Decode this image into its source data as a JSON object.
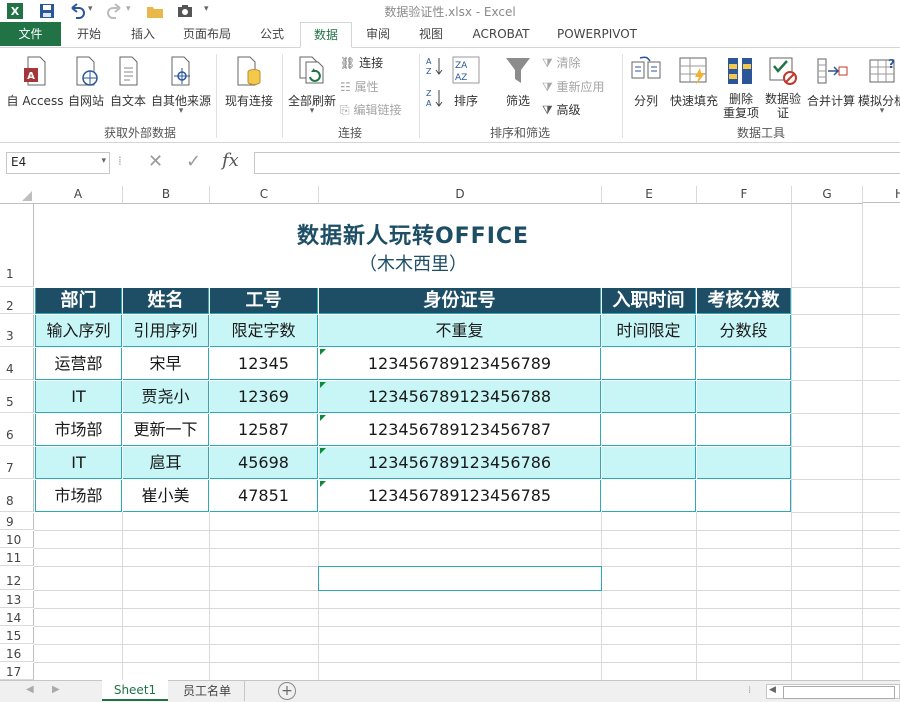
{
  "window": {
    "title": "数据验证性.xlsx - Excel"
  },
  "tabs": [
    {
      "label": "文件"
    },
    {
      "label": "开始"
    },
    {
      "label": "插入"
    },
    {
      "label": "页面布局"
    },
    {
      "label": "公式"
    },
    {
      "label": "数据"
    },
    {
      "label": "审阅"
    },
    {
      "label": "视图"
    },
    {
      "label": "ACROBAT"
    },
    {
      "label": "POWERPIVOT"
    }
  ],
  "ribbon": {
    "external": {
      "buttons": [
        "自 Access",
        "自网站",
        "自文本",
        "自其他来源",
        "现有连接"
      ],
      "group_label": "获取外部数据"
    },
    "connections": {
      "refresh_label": "全部刷新",
      "items": [
        "连接",
        "属性",
        "编辑链接"
      ],
      "group_label": "连接"
    },
    "sortfilter": {
      "sort_label": "排序",
      "filter_label": "筛选",
      "items": [
        "清除",
        "重新应用",
        "高级"
      ],
      "group_label": "排序和筛选"
    },
    "datatools": {
      "buttons": [
        "分列",
        "快速填充",
        "删除\n重复项",
        "数据验\n证",
        "合并计算",
        "模拟分析"
      ],
      "group_label": "数据工具"
    }
  },
  "formula_bar": {
    "name_box": "E4",
    "fx": "fx",
    "value": ""
  },
  "columns": [
    "A",
    "B",
    "C",
    "D",
    "E",
    "F",
    "G",
    "H"
  ],
  "rows": [
    "1",
    "2",
    "3",
    "4",
    "5",
    "6",
    "7",
    "8",
    "9",
    "10",
    "11",
    "12",
    "13",
    "14",
    "15",
    "16",
    "17"
  ],
  "sheet": {
    "title": "数据新人玩转OFFICE",
    "subtitle": "（木木西里）",
    "headers": [
      "部门",
      "姓名",
      "工号",
      "身份证号",
      "入职时间",
      "考核分数"
    ],
    "rules": [
      "输入序列",
      "引用序列",
      "限定字数",
      "不重复",
      "时间限定",
      "分数段"
    ],
    "data": [
      [
        "运营部",
        "宋早",
        "12345",
        "123456789123456789",
        "",
        ""
      ],
      [
        "IT",
        "贾尧小",
        "12369",
        "123456789123456788",
        "",
        ""
      ],
      [
        "市场部",
        "更新一下",
        "12587",
        "123456789123456787",
        "",
        ""
      ],
      [
        "IT",
        "扈耳",
        "45698",
        "123456789123456786",
        "",
        ""
      ],
      [
        "市场部",
        "崔小美",
        "47851",
        "123456789123456785",
        "",
        ""
      ]
    ]
  },
  "sheet_tabs": [
    "Sheet1",
    "员工名单"
  ],
  "colors": {
    "accent": "#217346",
    "header_fill": "#1d4e66",
    "rule_fill": "#c8f5f6",
    "band_fill": "#c8f5f6",
    "border": "#2aa9b8"
  }
}
